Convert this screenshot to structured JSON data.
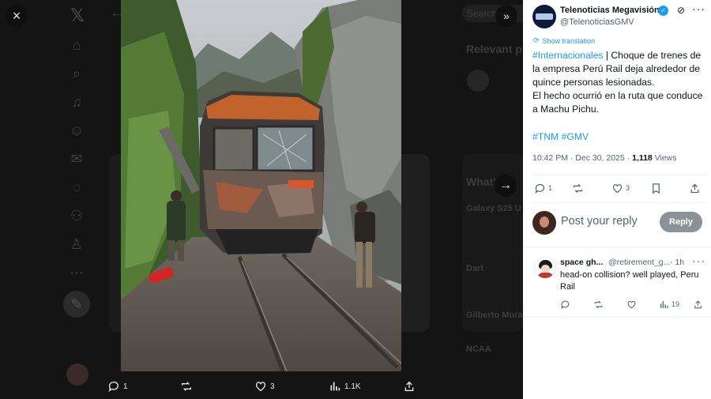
{
  "modal": {
    "close_icon": "×",
    "collapse_icon": "»",
    "next_icon": "→"
  },
  "background": {
    "search_placeholder": "Search",
    "relevant_header": "Relevant p",
    "whats_header": "What's",
    "trend_lines": [
      "Galaxy S25 U",
      "Dart",
      "Gilberto Mora",
      "NCAA"
    ]
  },
  "media_actions": {
    "replies": "1",
    "reposts": "",
    "likes": "3",
    "views": "1.1K"
  },
  "tweet": {
    "author_name": "Telenoticias Megavisión",
    "author_handle": "@TelenoticiasGMV",
    "show_translation": "Show translation",
    "hashtag_intl": "#Internacionales",
    "body_1": " | Choque de trenes de la empresa Perú Rail deja alrededor de quince personas lesionadas.",
    "body_2": "El hecho ocurrió en la ruta que conduce a Machu Pichu.",
    "tag_tnm": "#TNM",
    "tag_gmv": "#GMV",
    "time": "10:42 PM · Dec 30, 2025 · ",
    "views_count": "1,118",
    "views_label": " Views",
    "replies": "1",
    "reposts": "",
    "likes": "3"
  },
  "reply_box": {
    "placeholder": "Post your reply",
    "button": "Reply"
  },
  "comment": {
    "name": "space gh...",
    "handle": "@retirement_g...",
    "time": "· 1h",
    "text": "head-on collision? well played, Peru Rail",
    "views": "19"
  },
  "colors": {
    "accent": "#1d9bf0",
    "panel_bg": "#ffffff",
    "overlay_bg": "#141414"
  }
}
